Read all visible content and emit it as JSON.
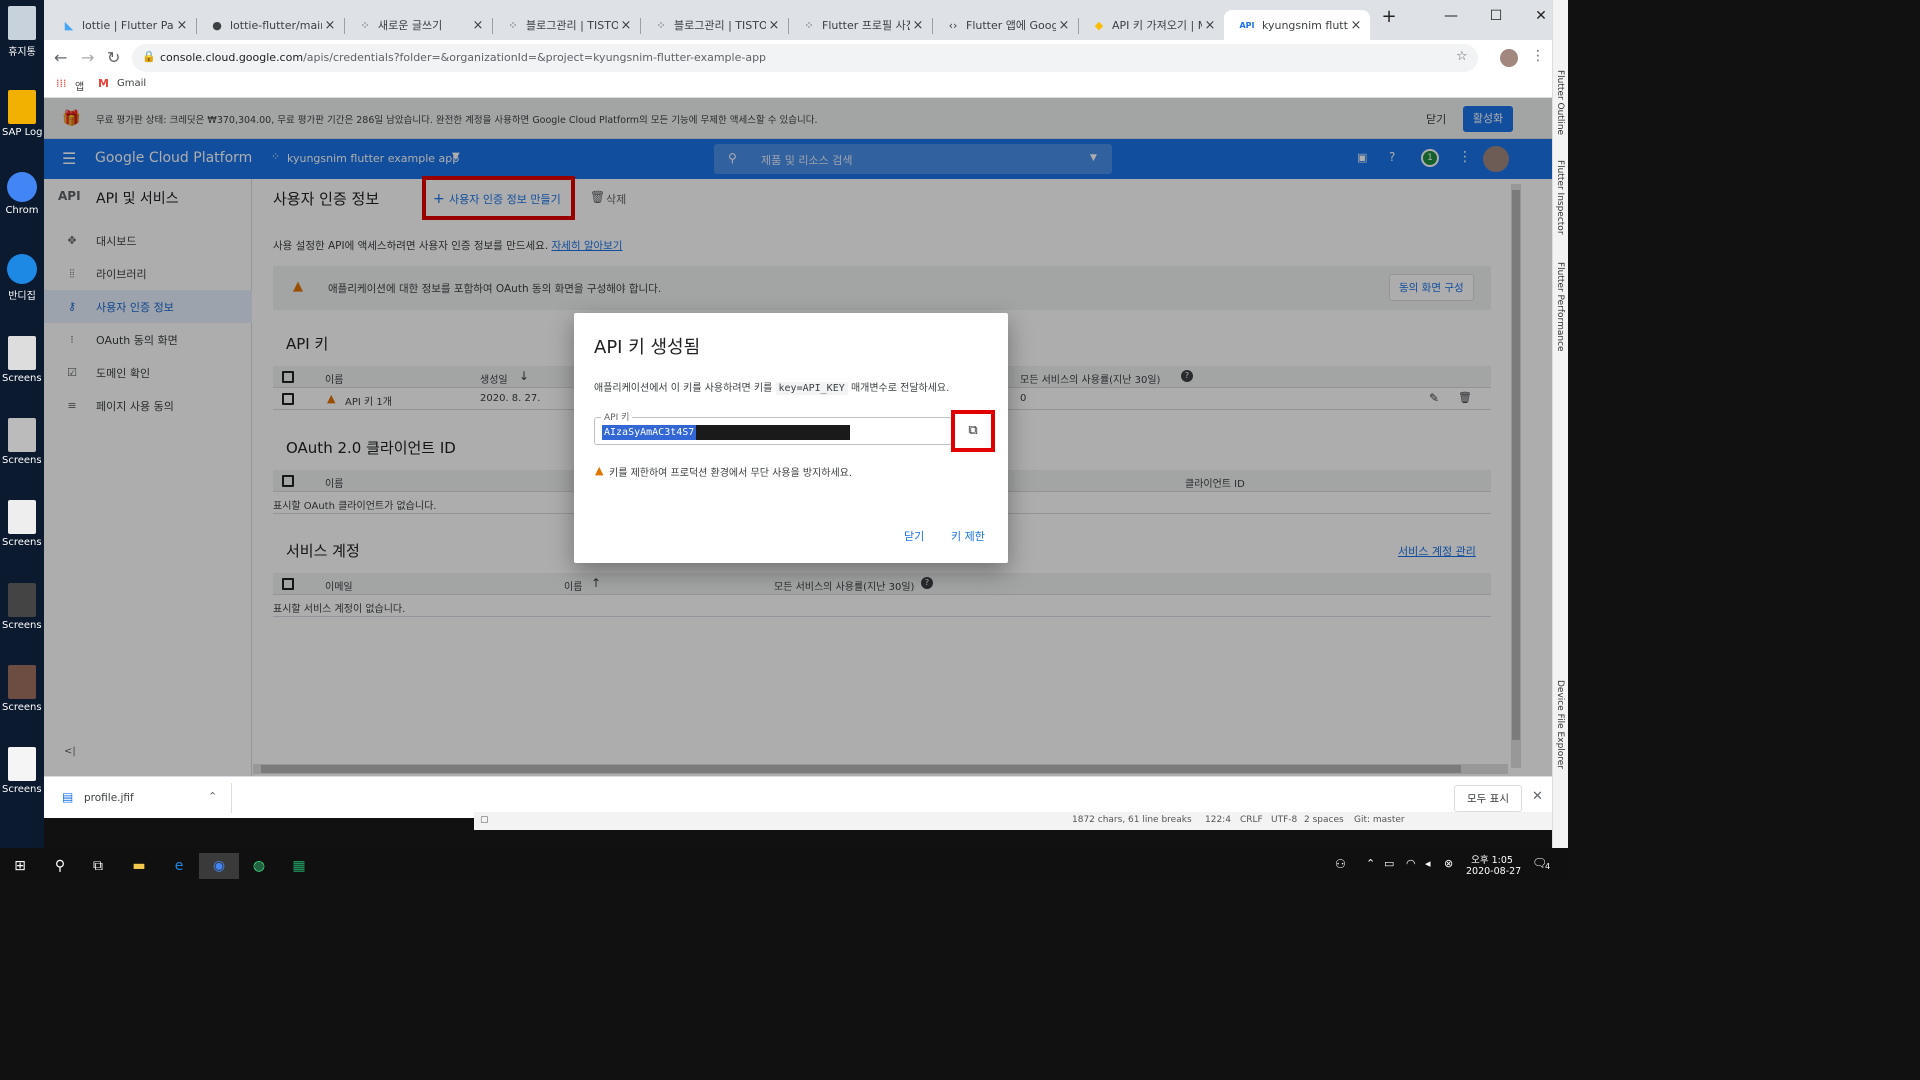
{
  "desktop": {
    "icons": [
      "휴지통",
      "SAP Log",
      "Chrom",
      "반디집",
      "Screensh",
      "Screensh",
      "Screensh",
      "Screensh",
      "Screensh",
      "Screensh"
    ]
  },
  "browser": {
    "tabs": [
      {
        "icon": "flutter-icon",
        "title": "lottie | Flutter Packag"
      },
      {
        "icon": "github-icon",
        "title": "lottie-flutter/main.da"
      },
      {
        "icon": "tistory-icon",
        "title": "새로운 글쓰기"
      },
      {
        "icon": "tistory-icon",
        "title": "블로그관리 | TISTOR"
      },
      {
        "icon": "tistory-icon",
        "title": "블로그관리 | TISTOR"
      },
      {
        "icon": "tistory-icon",
        "title": "Flutter 프로필 사진 "
      },
      {
        "icon": "code-icon",
        "title": "Flutter 앱에 Google"
      },
      {
        "icon": "google-ads-icon",
        "title": "API 키 가져오기 | M"
      },
      {
        "icon": "api-icon",
        "title": "kyungsnim flutter e",
        "prefix": "API"
      }
    ],
    "url_host": "console.cloud.google.com",
    "url_path": "/apis/credentials?folder=&organizationId=&project=kyungsnim-flutter-example-app",
    "bookmarks": [
      {
        "label": "앱"
      },
      {
        "label": "Gmail"
      }
    ]
  },
  "trial_banner": {
    "text": "무료 평가판 상태: 크레딧은 ₩370,304.00, 무료 평가판 기간은 286일 남았습니다. 완전한 계정을 사용하면 Google Cloud Platform의 모든 기능에 무제한 액세스할 수 있습니다.",
    "close_label": "닫기",
    "activate_label": "활성화"
  },
  "gcp_header": {
    "product": "Google Cloud Platform",
    "project": "kyungsnim flutter example app",
    "search_placeholder": "제품 및 리소스 검색",
    "notification_count": "1"
  },
  "sidebar": {
    "logo": "API",
    "title": "API 및 서비스",
    "items": [
      {
        "label": "대시보드",
        "icon": "dashboard-icon"
      },
      {
        "label": "라이브러리",
        "icon": "library-icon"
      },
      {
        "label": "사용자 인증 정보",
        "icon": "key-icon",
        "selected": true
      },
      {
        "label": "OAuth 동의 화면",
        "icon": "oauth-icon"
      },
      {
        "label": "도메인 확인",
        "icon": "domain-icon"
      },
      {
        "label": "페이지 사용 동의",
        "icon": "settings-list-icon"
      }
    ],
    "collapse_label": "<|"
  },
  "main": {
    "title": "사용자 인증 정보",
    "create_label": "사용자 인증 정보 만들기",
    "delete_label": "삭제",
    "intro": "사용 설정한 API에 액세스하려면 사용자 인증 정보를 만드세요.",
    "learn_more": "자세히 알아보기",
    "warning": "애플리케이션에 대한 정보를 포함하여 OAuth 동의 화면을 구성해야 합니다.",
    "consent_button": "동의 화면 구성",
    "api_keys": {
      "heading": "API 키",
      "col_name": "이름",
      "col_created": "생성일",
      "col_usage": "모든 서비스의 사용률(지난 30일)",
      "row": {
        "name": "API 키 1개",
        "created": "2020. 8. 27.",
        "usage": "0"
      }
    },
    "oauth": {
      "heading": "OAuth 2.0 클라이언트 ID",
      "col_name": "이름",
      "col_client": "클라이언트 ID",
      "empty": "표시할 OAuth 클라이언트가 없습니다."
    },
    "service_accounts": {
      "heading": "서비스 계정",
      "manage_link": "서비스 계정 관리",
      "col_email": "이메일",
      "col_name": "이름",
      "col_usage": "모든 서비스의 사용률(지난 30일)",
      "empty": "표시할 서비스 계정이 없습니다."
    }
  },
  "dialog": {
    "title": "API 키 생성됨",
    "desc_before": "애플리케이션에서 이 키를 사용하려면 키를",
    "desc_code": "key=API_KEY",
    "desc_after": "매개변수로 전달하세요.",
    "field_label": "API 키",
    "key_value": "AIzaSyAmAC3t4S7",
    "key_warning": "키를 제한하여 프로덕션 환경에서 무단 사용을 방지하세요.",
    "close_label": "닫기",
    "restrict_label": "키 제한"
  },
  "downloads": {
    "file": "profile.jfif",
    "show_all": "모두 표시"
  },
  "vscode_status": {
    "items": [
      "1872 chars, 61 line breaks",
      "122:4",
      "CRLF",
      "UTF-8",
      "2 spaces",
      "Git: master"
    ]
  },
  "right_panel": {
    "labels": [
      "Flutter Outline",
      "Flutter Inspector",
      "Flutter Performance",
      "Device File Explorer"
    ]
  },
  "taskbar": {
    "time": "오후 1:05",
    "date": "2020-08-27",
    "notification_count": "4"
  }
}
